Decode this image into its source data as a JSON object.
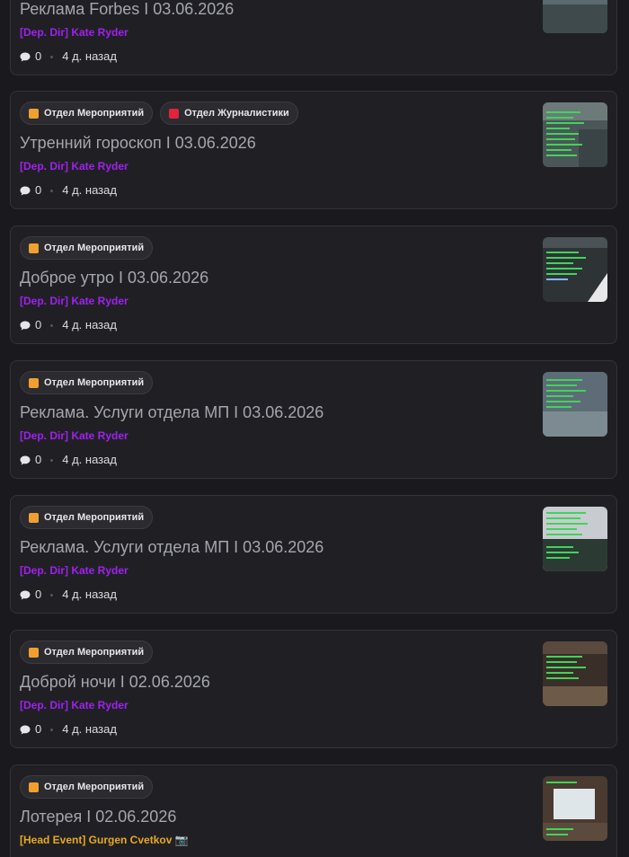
{
  "posts": [
    {
      "tags": [],
      "title": "Реклама Forbes I 03.06.2026",
      "author": "[Dep. Dir] Kate Ryder",
      "author_color": "#a020f0",
      "comments": "0",
      "time": "4 д. назад"
    },
    {
      "tags": [
        {
          "label": "Отдел Мероприятий",
          "color": "#f0a030"
        },
        {
          "label": "Отдел Журналистики",
          "color": "#e0243c"
        }
      ],
      "title": "Утренний гороскоп I 03.06.2026",
      "author": "[Dep. Dir] Kate Ryder",
      "author_color": "#a020f0",
      "comments": "0",
      "time": "4 д. назад"
    },
    {
      "tags": [
        {
          "label": "Отдел Мероприятий",
          "color": "#f0a030"
        }
      ],
      "title": "Доброе утро I 03.06.2026",
      "author": "[Dep. Dir] Kate Ryder",
      "author_color": "#a020f0",
      "comments": "0",
      "time": "4 д. назад"
    },
    {
      "tags": [
        {
          "label": "Отдел Мероприятий",
          "color": "#f0a030"
        }
      ],
      "title": "Реклама. Услуги отдела МП I 03.06.2026",
      "author": "[Dep. Dir] Kate Ryder",
      "author_color": "#a020f0",
      "comments": "0",
      "time": "4 д. назад"
    },
    {
      "tags": [
        {
          "label": "Отдел Мероприятий",
          "color": "#f0a030"
        }
      ],
      "title": "Реклама. Услуги отдела МП I 03.06.2026",
      "author": "[Dep. Dir] Kate Ryder",
      "author_color": "#a020f0",
      "comments": "0",
      "time": "4 д. назад"
    },
    {
      "tags": [
        {
          "label": "Отдел Мероприятий",
          "color": "#f0a030"
        }
      ],
      "title": "Доброй ночи I 02.06.2026",
      "author": "[Dep. Dir] Kate Ryder",
      "author_color": "#a020f0",
      "comments": "0",
      "time": "4 д. назад"
    },
    {
      "tags": [
        {
          "label": "Отдел Мероприятий",
          "color": "#f0a030"
        }
      ],
      "title": "Лотерея I 02.06.2026",
      "author": "[Head Event] Gurgen Cvetkov 📷",
      "author_color": "#e8a81e",
      "comments": "",
      "time": ""
    }
  ],
  "icons": {
    "comment": "speech-bubble-icon",
    "thumbnail": "game-screenshot-thumbnail"
  }
}
